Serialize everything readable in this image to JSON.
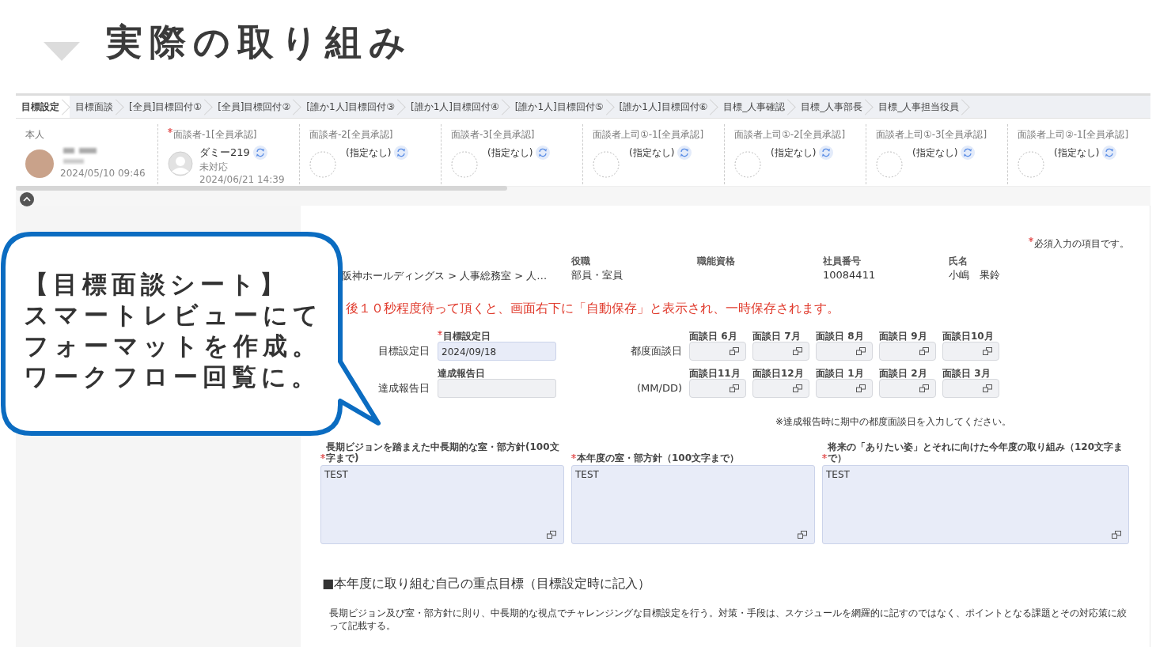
{
  "slide": {
    "title": "実際の取り組み"
  },
  "tabs": [
    {
      "label": "目標設定",
      "selected": true
    },
    {
      "label": "目標面談",
      "selected": false
    },
    {
      "label": "[全員]目標回付①",
      "selected": false
    },
    {
      "label": "[全員]目標回付②",
      "selected": false
    },
    {
      "label": "[誰か1人]目標回付③",
      "selected": false
    },
    {
      "label": "[誰か1人]目標回付④",
      "selected": false
    },
    {
      "label": "[誰か1人]目標回付⑤",
      "selected": false
    },
    {
      "label": "[誰か1人]目標回付⑥",
      "selected": false
    },
    {
      "label": "目標_人事確認",
      "selected": false
    },
    {
      "label": "目標_人事部長",
      "selected": false
    },
    {
      "label": "目標_人事担当役員",
      "selected": false
    }
  ],
  "approvers": [
    {
      "kind": "self",
      "label": "本人",
      "required": false,
      "date": "2024/05/10 09:46"
    },
    {
      "kind": "assigned",
      "label": "面談者-1[全員承認]",
      "required": true,
      "name": "ダミー219",
      "status": "未対応",
      "date": "2024/06/21 14:39"
    },
    {
      "kind": "empty",
      "label": "面談者-2[全員承認]",
      "required": false,
      "name": "(指定なし)"
    },
    {
      "kind": "empty",
      "label": "面談者-3[全員承認]",
      "required": false,
      "name": "(指定なし)"
    },
    {
      "kind": "empty",
      "label": "面談者上司①-1[全員承認]",
      "required": false,
      "name": "(指定なし)"
    },
    {
      "kind": "empty",
      "label": "面談者上司①-2[全員承認]",
      "required": false,
      "name": "(指定なし)"
    },
    {
      "kind": "empty",
      "label": "面談者上司①-3[全員承認]",
      "required": false,
      "name": "(指定なし)"
    },
    {
      "kind": "empty",
      "label": "面談者上司②-1[全員承認]",
      "required": false,
      "name": "(指定なし)"
    }
  ],
  "form": {
    "required_note": "必須入力の項目です。",
    "breadcrumb": "阪神ホールディングス > 人事総務室 > 人…",
    "info": [
      {
        "label": "役職",
        "value": "部員・室員"
      },
      {
        "label": "職能資格"
      },
      {
        "label": "社員番号",
        "value": "10084411"
      },
      {
        "label": "氏名",
        "value": "小嶋　果鈴"
      }
    ],
    "notice": "後１０秒程度待って頂くと、画面右下に「自動保存」と表示され、一時保存されます。",
    "date_rows": [
      {
        "label": "目標設定日",
        "field_label": "目標設定日",
        "required": true,
        "value": "2024/09/18",
        "side_label": "都度面談日"
      },
      {
        "label": "達成報告日",
        "field_label": "達成報告日",
        "required": false,
        "side_label": "(MM/DD)"
      }
    ],
    "months": [
      {
        "label": "面談日 6月"
      },
      {
        "label": "面談日 7月"
      },
      {
        "label": "面談日 8月"
      },
      {
        "label": "面談日 9月"
      },
      {
        "label": "面談日10月"
      },
      {
        "label": "面談日11月"
      },
      {
        "label": "面談日12月"
      },
      {
        "label": "面談日 1月"
      },
      {
        "label": "面談日 2月"
      },
      {
        "label": "面談日 3月"
      }
    ],
    "months_note": "※達成報告時に期中の都度面談日を入力してください。",
    "textareas": [
      {
        "label": "長期ビジョンを踏まえた中長期的な室・部方針(100文字まで)",
        "required": true,
        "value": "TEST"
      },
      {
        "label": "本年度の室・部方針（100文字まで）",
        "required": true,
        "value": "TEST"
      },
      {
        "label": "将来の「ありたい姿」とそれに向けた今年度の取り組み（120文字まで）",
        "required": true,
        "value": "TEST"
      }
    ],
    "section_heading": "■本年度に取り組む自己の重点目標（目標設定時に記入）",
    "section_description": "長期ビジョン及び室・部方針に則り、中長期的な視点でチャレンジングな目標設定を行う。対策・手段は、スケジュールを網羅的に記すのではなく、ポイントとなる課題とその対応策に絞って記載する。"
  },
  "callout": {
    "lines": [
      "【目標面談シート】",
      "スマートレビューにて",
      "フォーマットを作成。",
      "ワークフロー回覧に。"
    ]
  }
}
